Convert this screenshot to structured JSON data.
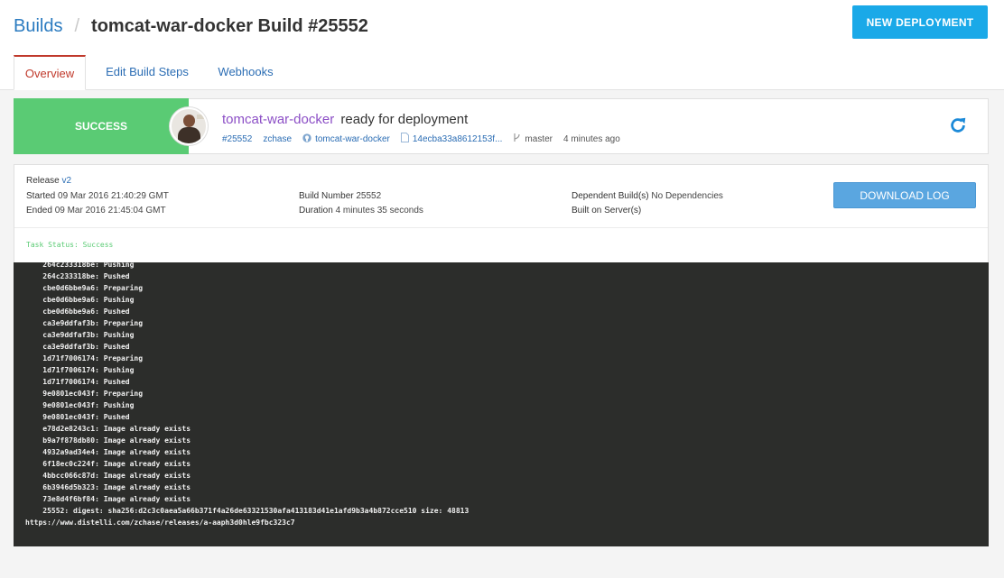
{
  "breadcrumb": {
    "root": "Builds",
    "separator": "/",
    "title": "tomcat-war-docker Build #25552"
  },
  "actions": {
    "new_deployment": "NEW DEPLOYMENT",
    "download_log": "DOWNLOAD LOG"
  },
  "tabs": [
    {
      "label": "Overview",
      "active": true
    },
    {
      "label": "Edit Build Steps",
      "active": false
    },
    {
      "label": "Webhooks",
      "active": false
    }
  ],
  "build": {
    "status": "SUCCESS",
    "status_color": "#5acb74",
    "app": "tomcat-war-docker",
    "message": "ready for deployment",
    "number_link": "#25552",
    "user": "zchase",
    "repo": "tomcat-war-docker",
    "commit": "14ecba33a8612153f...",
    "branch": "master",
    "time_ago": "4 minutes ago"
  },
  "details": {
    "release_label": "Release",
    "release_value": "v2",
    "started_label": "Started",
    "started_value": "09 Mar 2016 21:40:29 GMT",
    "ended_label": "Ended",
    "ended_value": "09 Mar 2016 21:45:04 GMT",
    "build_number_label": "Build Number",
    "build_number_value": "25552",
    "duration_label": "Duration",
    "duration_value": "4 minutes 35 seconds",
    "dependent_label": "Dependent Build(s)",
    "dependent_value": "No Dependencies",
    "server_label": "Built on Server(s)",
    "task_status": "Task Status: Success"
  },
  "log_lines": [
    "    264c233318be: Pushing",
    "    264c233318be: Pushed",
    "    cbe0d6bbe9a6: Preparing",
    "    cbe0d6bbe9a6: Pushing",
    "    cbe0d6bbe9a6: Pushed",
    "    ca3e9ddfaf3b: Preparing",
    "    ca3e9ddfaf3b: Pushing",
    "    ca3e9ddfaf3b: Pushed",
    "    1d71f7006174: Preparing",
    "    1d71f7006174: Pushing",
    "    1d71f7006174: Pushed",
    "    9e0801ec043f: Preparing",
    "    9e0801ec043f: Pushing",
    "    9e0801ec043f: Pushed",
    "    e78d2e8243c1: Image already exists",
    "    b9a7f878db80: Image already exists",
    "    4932a9ad34e4: Image already exists",
    "    6f18ec0c224f: Image already exists",
    "    4bbcc066c87d: Image already exists",
    "    6b3946d5b323: Image already exists",
    "    73e8d4f6bf84: Image already exists",
    "    25552: digest: sha256:d2c3c0aea5a66b371f4a26de63321530afa413183d41e1afd9b3a4b872cce510 size: 48813",
    "https://www.distelli.com/zchase/releases/a-aaph3d0hle9fbc323c7"
  ]
}
